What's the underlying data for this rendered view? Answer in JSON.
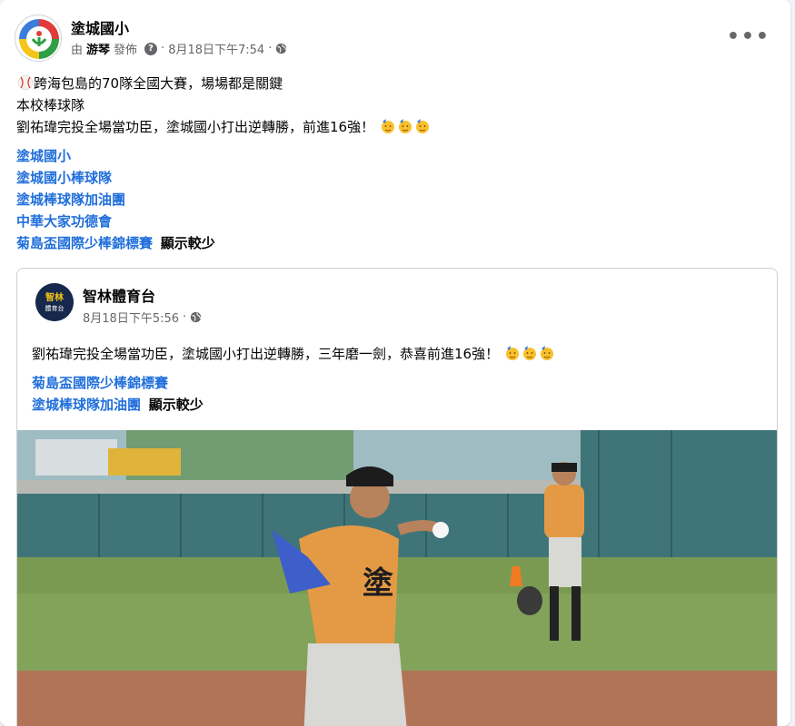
{
  "post": {
    "page_name": "塗城國小",
    "by_prefix": "由",
    "author": "游琴",
    "published": "發佈",
    "timestamp": "8月18日下午7:54",
    "dot": "·",
    "more": "•••",
    "text_line1": "跨海包島的70隊全國大賽，場場都是關鍵",
    "text_line2": "本校棒球隊",
    "text_line3": "劉祐瑋完投全場當功臣，塗城國小打出逆轉勝，前進16強！",
    "tags": [
      "塗城國小",
      "塗城國小棒球隊",
      "塗城棒球隊加油團",
      "中華大家功德會",
      "菊島盃國際少棒錦標賽"
    ],
    "show_less": "顯示較少"
  },
  "shared": {
    "page_name": "智林體育台",
    "avatar_text_1": "智林",
    "avatar_text_2": "體育台",
    "timestamp": "8月18日下午5:56",
    "dot": "·",
    "text": "劉祐瑋完投全場當功臣，塗城國小打出逆轉勝，三年磨一劍，恭喜前進16強！",
    "tags": [
      "菊島盃國際少棒錦標賽",
      "塗城棒球隊加油團"
    ],
    "show_less": "顯示較少"
  },
  "colors": {
    "link": "#216fdb",
    "meta": "#65676b"
  },
  "icons": {
    "globe": "globe-icon",
    "help": "help-icon",
    "baseball": "baseball-emoji"
  }
}
